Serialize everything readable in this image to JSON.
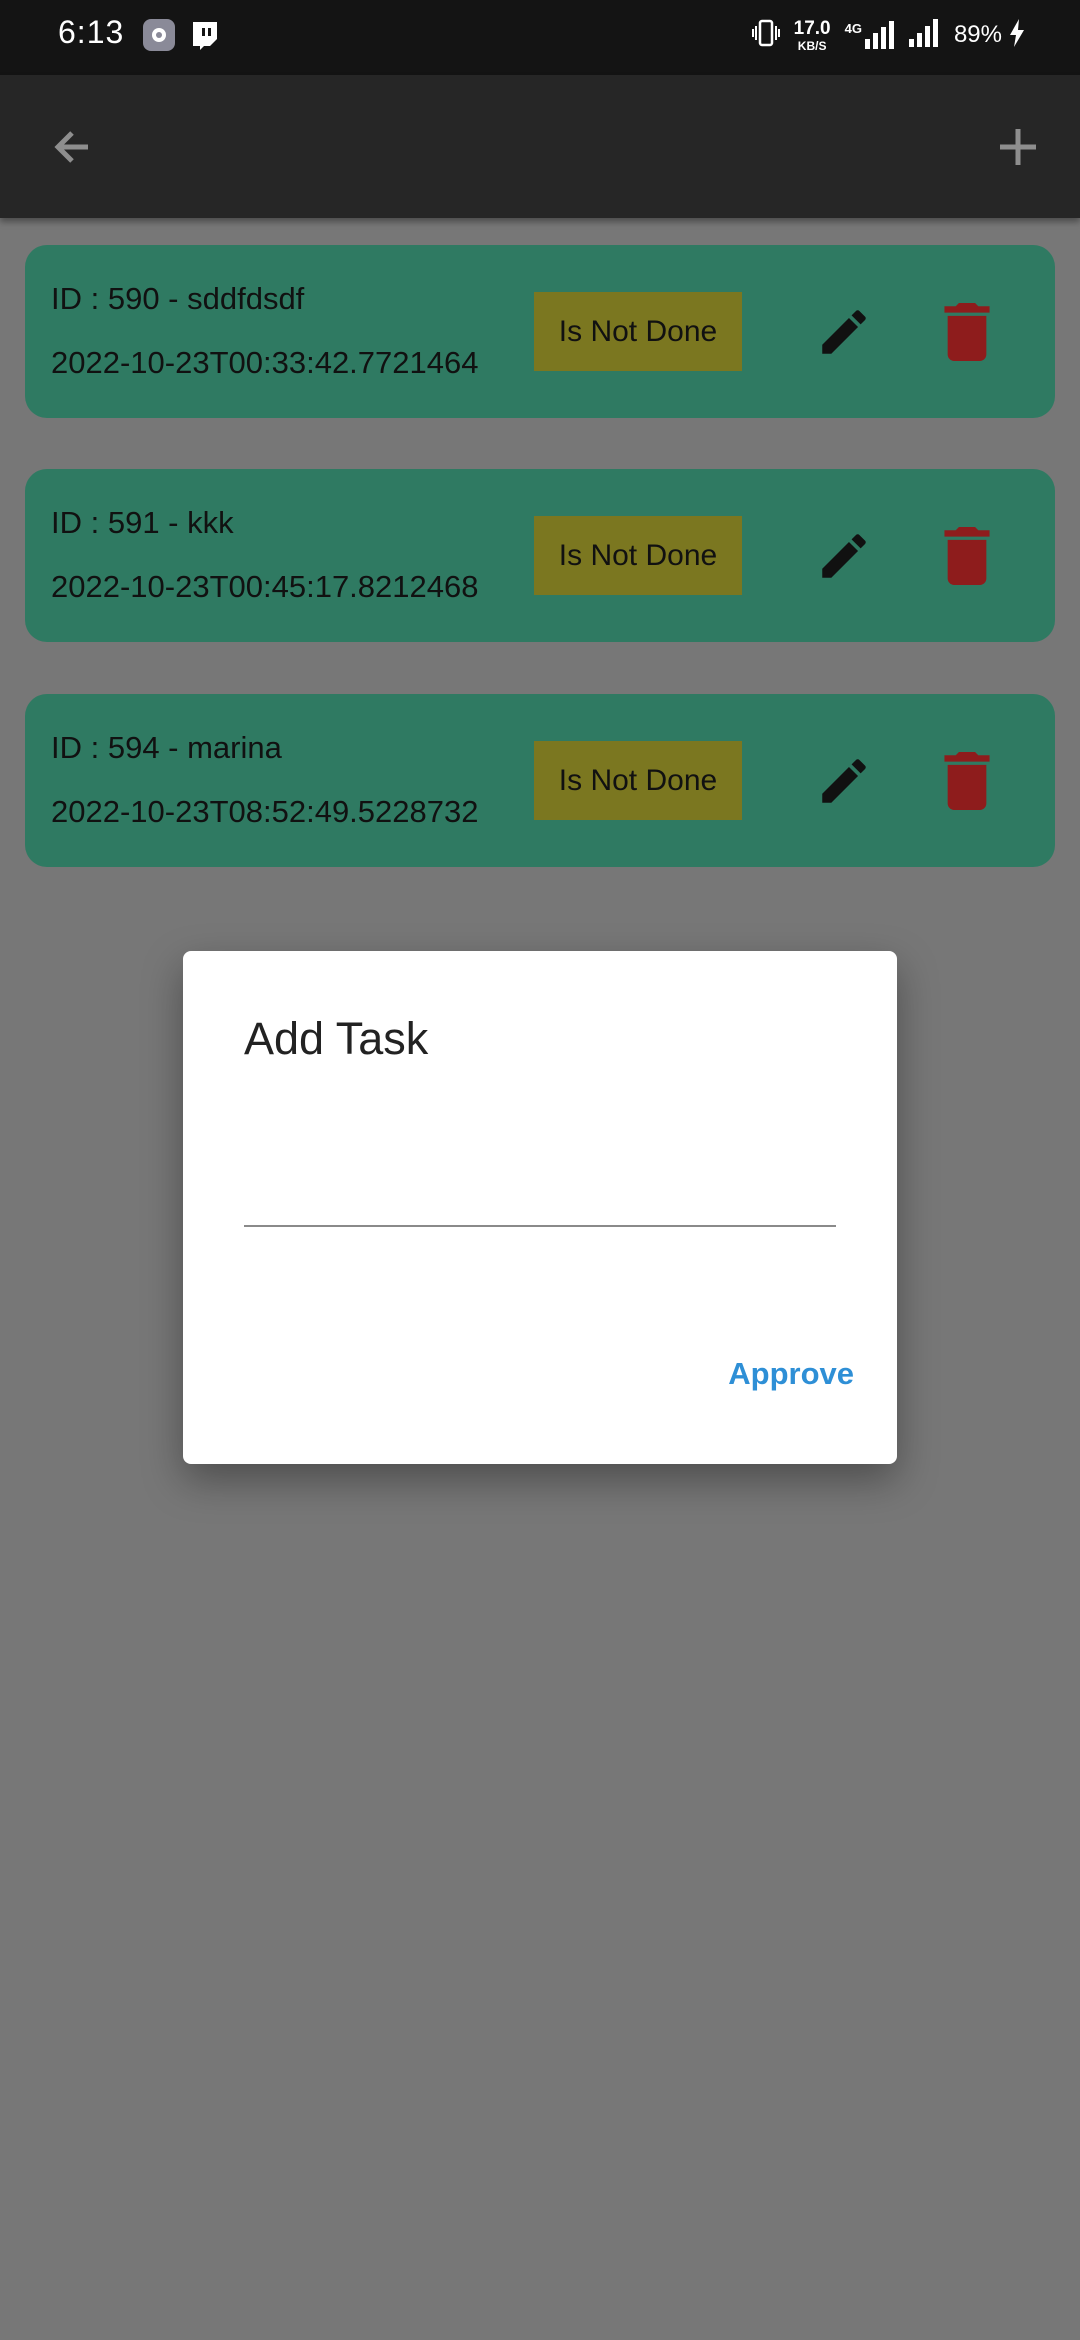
{
  "status_bar": {
    "time": "6:13",
    "speed_value": "17.0",
    "speed_unit": "KB/S",
    "network": "4G",
    "battery": "89%"
  },
  "app_bar": {
    "back_icon": "arrow-left-icon",
    "add_icon": "plus-icon"
  },
  "tasks": [
    {
      "title": "ID : 590 - sddfdsdf",
      "date": "2022-10-23T00:33:42.7721464",
      "status": "Is Not Done"
    },
    {
      "title": "ID : 591 - kkk",
      "date": "2022-10-23T00:45:17.8212468",
      "status": "Is Not Done"
    },
    {
      "title": "ID : 594 - marina",
      "date": "2022-10-23T08:52:49.5228732",
      "status": "Is Not Done"
    }
  ],
  "dialog": {
    "title": "Add Task",
    "input_value": "",
    "approve_label": "Approve"
  },
  "colors": {
    "card": "#2f7a62",
    "status_button": "#7b7720",
    "delete": "#8e1c1c",
    "approve": "#2e8fd6"
  }
}
